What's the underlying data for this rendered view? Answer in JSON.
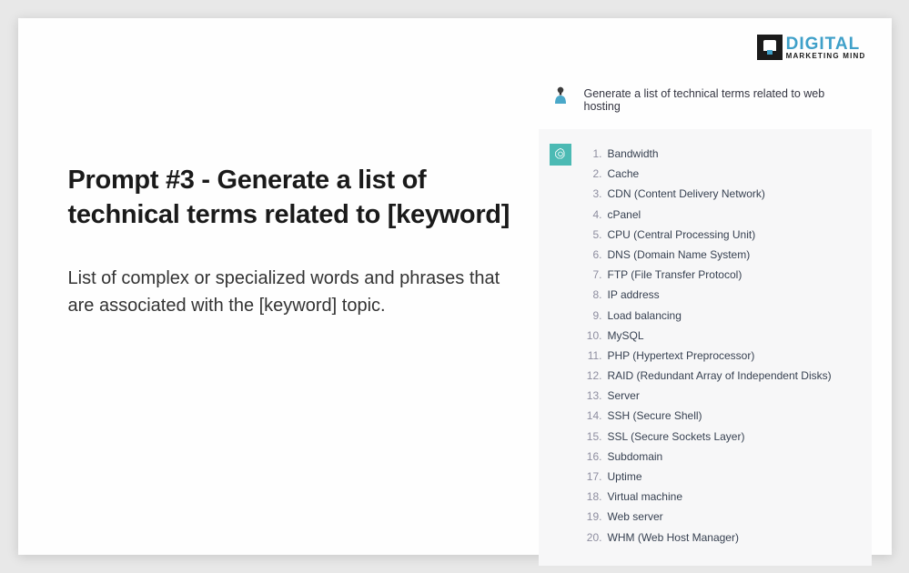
{
  "logo": {
    "main": "DIGITAL",
    "sub": "MARKETING MIND"
  },
  "heading": "Prompt #3 - Generate a list of technical terms related to [keyword]",
  "description": "List of complex or specialized words and phrases that are associated with the [keyword] topic.",
  "chat": {
    "prompt": "Generate a list of technical terms related to web hosting",
    "terms": [
      "Bandwidth",
      "Cache",
      "CDN (Content Delivery Network)",
      "cPanel",
      "CPU (Central Processing Unit)",
      "DNS (Domain Name System)",
      "FTP (File Transfer Protocol)",
      "IP address",
      "Load balancing",
      "MySQL",
      "PHP (Hypertext Preprocessor)",
      "RAID (Redundant Array of Independent Disks)",
      "Server",
      "SSH (Secure Shell)",
      "SSL (Secure Sockets Layer)",
      "Subdomain",
      "Uptime",
      "Virtual machine",
      "Web server",
      "WHM (Web Host Manager)"
    ]
  }
}
